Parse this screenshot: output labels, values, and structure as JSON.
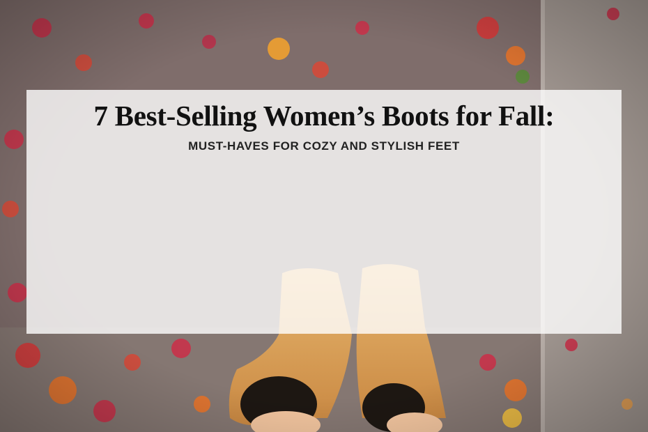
{
  "hero": {
    "title": "7 Best-Selling Women’s Boots for Fall:",
    "subtitle": "MUST-HAVES FOR COZY AND STYLISH FEET"
  },
  "colors": {
    "stone": "#8a7a74",
    "leaf_red": "#c8324a",
    "leaf_orange": "#e8742a",
    "boot_tan": "#d9a25e",
    "overlay": "#ffffff"
  }
}
